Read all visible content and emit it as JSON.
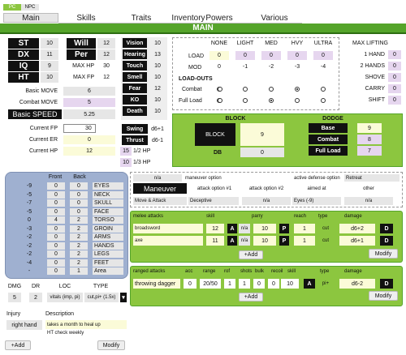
{
  "toggle": {
    "pc": "PC",
    "npc": "NPC"
  },
  "tabs": [
    "Main",
    "Skills",
    "Traits",
    "Inventory",
    "Powers",
    "Various"
  ],
  "title": "MAIN",
  "attrs": {
    "st": [
      "ST",
      "10"
    ],
    "dx": [
      "DX",
      "11"
    ],
    "iq": [
      "IQ",
      "9"
    ],
    "ht": [
      "HT",
      "10"
    ],
    "will": [
      "Will",
      "12"
    ],
    "per": [
      "Per",
      "12"
    ],
    "maxhp": [
      "MAX HP",
      "30"
    ],
    "maxfp": [
      "MAX FP",
      "12"
    ]
  },
  "senses": [
    [
      "Vision",
      "10"
    ],
    [
      "Hearing",
      "13"
    ],
    [
      "Touch",
      "10"
    ],
    [
      "Smell",
      "10"
    ],
    [
      "Fear",
      "12"
    ],
    [
      "KO",
      "10"
    ],
    [
      "Death",
      "10"
    ]
  ],
  "basic": {
    "bm_label": "Basic MOVE",
    "bm": "6",
    "cm_label": "Combat MOVE",
    "cm": "5",
    "bs_label": "Basic SPEED",
    "bs": "5.25"
  },
  "stats": {
    "fp_label": "Current FP",
    "fp": "30",
    "er_label": "Current ER",
    "er": "0",
    "hp_label": "Current HP",
    "hp": "12",
    "half_v": "15",
    "half": "1/2 HP",
    "third_v": "10",
    "third": "1/3 HP"
  },
  "swing": {
    "swing": "Swing",
    "swing_v": "d6+1",
    "thrust": "Thrust",
    "thrust_v": "d6-1"
  },
  "load": {
    "headers": [
      "NONE",
      "LIGHT",
      "MED",
      "HVY",
      "ULTRA"
    ],
    "load_label": "LOAD",
    "mod_label": "MOD",
    "load": [
      "0",
      "0",
      "0",
      "0",
      "0"
    ],
    "mod": [
      "0",
      "-1",
      "-2",
      "-3",
      "-4"
    ],
    "loadouts": "LOAD-OUTS",
    "combat": "Combat",
    "fullload": "Full Load"
  },
  "lifting": {
    "title": "MAX LIFTING",
    "rows": [
      [
        "1 HAND",
        "0"
      ],
      [
        "2 HANDS",
        "0"
      ],
      [
        "SHOVE",
        "0"
      ],
      [
        "CARRY",
        "0"
      ],
      [
        "SHIFT",
        "0"
      ]
    ]
  },
  "defense": {
    "block": "BLOCK",
    "block_btn": "BLOCK",
    "block_v": "9",
    "db": "DB",
    "db_v": "0",
    "dodge": "DODGE",
    "base": "Base",
    "base_v": "9",
    "combat": "Combat",
    "combat_v": "8",
    "full": "Full Load",
    "full_v": "7"
  },
  "body": {
    "front": "Front",
    "back": "Back",
    "rows": [
      [
        "-9",
        "0",
        "0",
        "EYES"
      ],
      [
        "-5",
        "0",
        "0",
        "NECK"
      ],
      [
        "-7",
        "0",
        "0",
        "SKULL"
      ],
      [
        "-5",
        "0",
        "0",
        "FACE"
      ],
      [
        "0",
        "4",
        "2",
        "TORSO"
      ],
      [
        "-3",
        "0",
        "2",
        "GROIN"
      ],
      [
        "-2",
        "0",
        "2",
        "ARMS"
      ],
      [
        "-2",
        "0",
        "2",
        "HANDS"
      ],
      [
        "-2",
        "0",
        "2",
        "LEGS"
      ],
      [
        "-4",
        "0",
        "2",
        "FEET"
      ],
      [
        "-",
        "0",
        "1",
        "Area"
      ]
    ]
  },
  "maneuver": {
    "na1": "n/a",
    "mo_label": "maneuver option",
    "ado_label": "active defense option",
    "retreat": "Retreat",
    "maneuver": "Maneuver",
    "ao1": "attack option #1",
    "ao2": "attack option #2",
    "aimed": "aimed at",
    "other": "other",
    "move": "Move & Attack",
    "deceptive": "Deceptive",
    "na2": "n/a",
    "eyes": "Eyes (-9)",
    "na3": "n/a"
  },
  "melee": {
    "headers": [
      "melee attacks",
      "skill",
      "parry",
      "reach",
      "type",
      "damage"
    ],
    "rows": [
      [
        "broadsword",
        "12",
        "A",
        "n/a",
        "10",
        "P",
        "1",
        "cut",
        "d6+2",
        "D"
      ],
      [
        "axe",
        "11",
        "A",
        "n/a",
        "10",
        "P",
        "1",
        "cut",
        "d6+1",
        "D"
      ]
    ],
    "add": "+Add",
    "modify": "Modify"
  },
  "ranged": {
    "headers": [
      "ranged attacks",
      "acc",
      "range",
      "rof",
      "shots",
      "bulk",
      "recoil",
      "skill",
      "type",
      "damage"
    ],
    "row": [
      "throwing dagger",
      "0",
      "20/50",
      "1",
      "1",
      "0",
      "0",
      "10",
      "A",
      "pi+",
      "d6-2",
      "D"
    ],
    "add": "+Add",
    "modify": "Modify"
  },
  "injury": {
    "dmg": "DMG",
    "dr": "DR",
    "loc": "LOC",
    "type": "TYPE",
    "dmg_v": "5",
    "dr_v": "2",
    "loc_v": "vitals (imp, pi)",
    "type_v": "cut,pi+ (1.5x)",
    "injury": "Injury",
    "desc": "Description",
    "where": "right hand",
    "text1": "takes a month to heal up",
    "text2": "HT check weekly",
    "add": "+Add",
    "modify": "Modify"
  },
  "colors": {
    "green": "#8cc63f",
    "darkgreen": "#55a42a",
    "lavender": "#e6d6ef",
    "yellow": "#fbfbd8",
    "blue": "#9fb0d0"
  }
}
